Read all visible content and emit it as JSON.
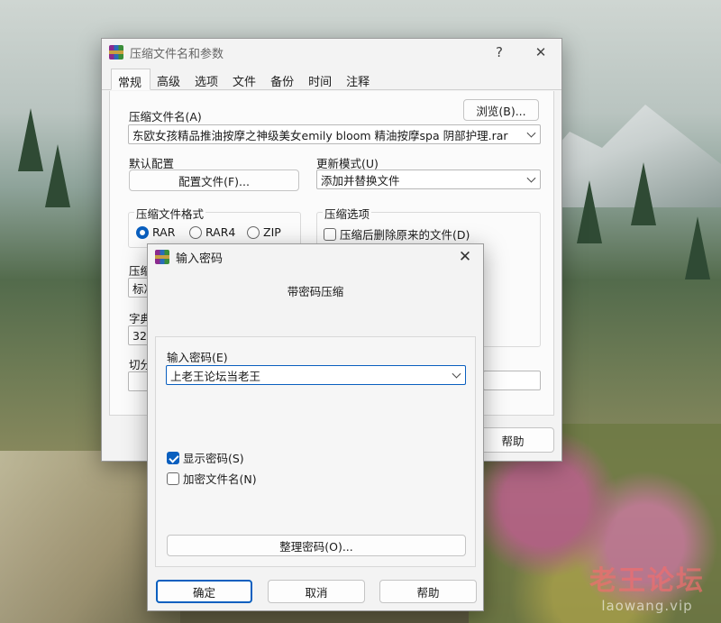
{
  "main_dialog": {
    "title": "压缩文件名和参数",
    "help_title_btn": "?",
    "close_title_btn": "✕",
    "tabs": [
      "常规",
      "高级",
      "选项",
      "文件",
      "备份",
      "时间",
      "注释"
    ],
    "archive_name_label": "压缩文件名(A)",
    "browse_button": "浏览(B)...",
    "archive_name_value": "东欧女孩精品推油按摩之神级美女emily bloom 精油按摩spa 阴部护理.rar",
    "default_profile_label": "默认配置",
    "profile_button": "配置文件(F)...",
    "update_mode_label": "更新模式(U)",
    "update_mode_value": "添加并替换文件",
    "format_group_title": "压缩文件格式",
    "format_options": [
      "RAR",
      "RAR4",
      "ZIP"
    ],
    "format_selected": "RAR",
    "options_group_title": "压缩选项",
    "delete_after_label": "压缩后删除原来的文件(D)",
    "partial_labels": {
      "compression_method": "压缩",
      "compression_value": "标准",
      "dictionary": "字典",
      "dictionary_value": "32",
      "split": "切分"
    },
    "help_button": "帮助"
  },
  "password_dialog": {
    "title": "输入密码",
    "close_btn": "✕",
    "heading": "带密码压缩",
    "enter_password_label": "输入密码(E)",
    "password_value": "上老王论坛当老王",
    "show_password_label": "显示密码(S)",
    "show_password_checked": true,
    "encrypt_names_label": "加密文件名(N)",
    "encrypt_names_checked": false,
    "organize_button": "整理密码(O)...",
    "ok_button": "确定",
    "cancel_button": "取消",
    "help_button": "帮助"
  },
  "watermark": {
    "cn": "老王论坛",
    "en": "laowang.vip"
  },
  "colors": {
    "accent": "#0a5fbf",
    "dialog_bg": "#f3f3f3"
  }
}
